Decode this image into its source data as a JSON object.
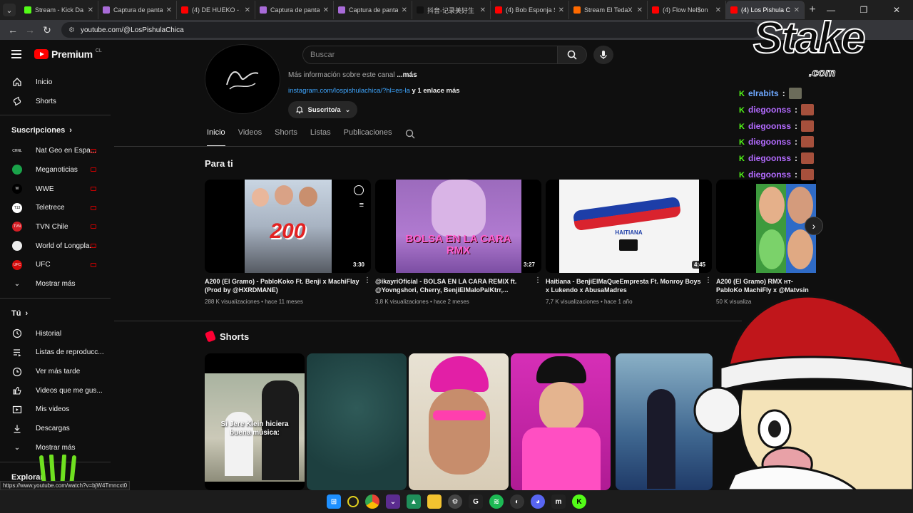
{
  "browser": {
    "tabs": [
      {
        "label": "Stream - Kick Da",
        "color": "#53fc18",
        "active": false
      },
      {
        "label": "Captura de panta",
        "color": "#a86bd8",
        "active": false
      },
      {
        "label": "(4) DE HUEKO - &",
        "color": "#ff0000",
        "active": false
      },
      {
        "label": "Captura de panta",
        "color": "#a86bd8",
        "active": false
      },
      {
        "label": "Captura de panta",
        "color": "#a86bd8",
        "active": false
      },
      {
        "label": "抖音-记录美好生",
        "color": "#111111",
        "active": false
      },
      {
        "label": "(4) Bob Esponja S",
        "color": "#ff0000",
        "active": false
      },
      {
        "label": "Stream El TedaX |",
        "color": "#ff6a00",
        "active": false
      },
      {
        "label": "(4) Flow Nel$on",
        "color": "#ff0000",
        "active": false
      },
      {
        "label": "(4) Los Pishula C",
        "color": "#ff0000",
        "active": true
      }
    ],
    "new_tab": "+",
    "url": "youtube.com/@LosPishulaChica",
    "status_url": "https://www.youtube.com/watch?v=bjW4Tmncxt0"
  },
  "header": {
    "logo_text": "Premium",
    "country_code": "CL",
    "search_placeholder": "Buscar"
  },
  "sidebar": {
    "main": [
      {
        "label": "Inicio",
        "icon": "home-icon"
      },
      {
        "label": "Shorts",
        "icon": "shorts-icon"
      }
    ],
    "subscriptions_title": "Suscripciones",
    "subscriptions": [
      {
        "label": "Nat Geo en Espa...",
        "avatar": "#111",
        "avatar_text": "CHNL"
      },
      {
        "label": "Meganoticias",
        "avatar": "#1aa34a",
        "avatar_text": ""
      },
      {
        "label": "WWE",
        "avatar": "#000",
        "avatar_text": "W"
      },
      {
        "label": "Teletrece",
        "avatar": "#fff",
        "avatar_text": "T13"
      },
      {
        "label": "TVN Chile",
        "avatar": "#d41f26",
        "avatar_text": "TVN"
      },
      {
        "label": "World of Longpla...",
        "avatar": "#eee",
        "avatar_text": ""
      },
      {
        "label": "UFC",
        "avatar": "#d20a0a",
        "avatar_text": "UFC"
      }
    ],
    "show_more": "Mostrar más",
    "you_title": "Tú",
    "you": [
      {
        "label": "Historial",
        "icon": "history-icon"
      },
      {
        "label": "Listas de reproducc...",
        "icon": "playlist-icon"
      },
      {
        "label": "Ver más tarde",
        "icon": "watch-later-icon"
      },
      {
        "label": "Videos que me gus...",
        "icon": "like-icon"
      },
      {
        "label": "Mis videos",
        "icon": "my-videos-icon"
      },
      {
        "label": "Descargas",
        "icon": "download-icon"
      }
    ],
    "show_more_2": "Mostrar más",
    "explore_title": "Explorar"
  },
  "channel": {
    "more_info": "Más información sobre este canal",
    "more_info_link": "...más",
    "link": "instagram.com/lospishulachica/?hl=es-la",
    "link_more": "y 1 enlace más",
    "subscribed_label": "Suscrito/a",
    "tabs": [
      "Inicio",
      "Videos",
      "Shorts",
      "Listas",
      "Publicaciones"
    ]
  },
  "for_you": {
    "title": "Para ti",
    "videos": [
      {
        "title": "A200 (El Gramo) - PabloKoko Ft. Benji x MachiFlay (Prod by @HXRDMANE)",
        "views": "288 K visualizaciones",
        "age": "hace 11 meses",
        "duration": "3:30",
        "thumb_text": "200"
      },
      {
        "title": "@ikayriOficial - BOLSA EN LA CARA REMIX ft. @Yovngshori, Cherry, BenjiElMaloPalKtrr,...",
        "views": "3,8 K visualizaciones",
        "age": "hace 2 meses",
        "duration": "3:27",
        "thumb_text": "BOLSA EN LA CARA RMX"
      },
      {
        "title": "Haitiana - BenjiElMaQueEmpresta Ft. Monroy Boys x Lukendo x AbusaMadres",
        "views": "7,7 K visualizaciones",
        "age": "hace 1 año",
        "duration": "4:45",
        "thumb_text": "HAITIANA"
      },
      {
        "title": "A200 (El Gramo) RMX ʜᴛ- PabloKo MachiFly x @Matvsin",
        "views": "50 K visualiza",
        "age": "",
        "duration": "",
        "thumb_text": ""
      }
    ]
  },
  "shorts": {
    "title": "Shorts",
    "caption_1": "Si Jere Klein hiciera buena música:"
  },
  "overlay": {
    "brand": "Stake",
    "brand_sub": ".com",
    "chat": [
      {
        "user": "elrabits",
        "color": "#6ea8ff"
      },
      {
        "user": "diegoonss",
        "color": "#b36bff"
      },
      {
        "user": "diegoonss",
        "color": "#b36bff"
      },
      {
        "user": "diegoonss",
        "color": "#b36bff"
      },
      {
        "user": "diegoonss",
        "color": "#b36bff"
      },
      {
        "user": "diegoonss",
        "color": "#b36bff"
      }
    ]
  }
}
